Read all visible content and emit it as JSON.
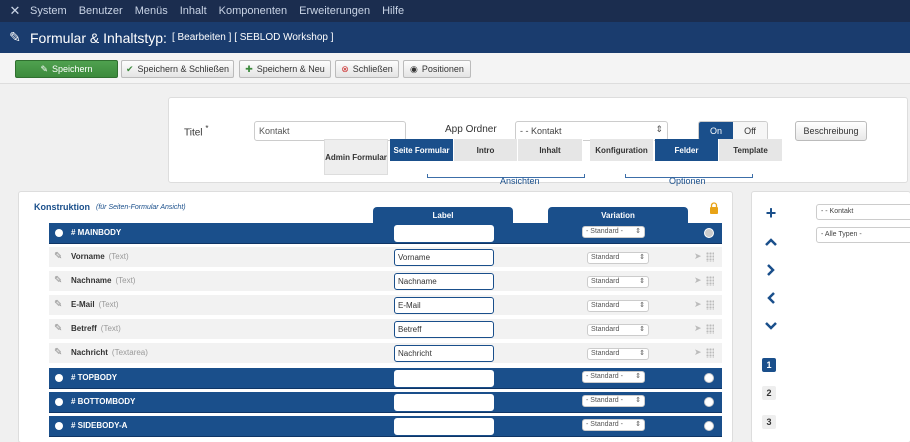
{
  "topnav": {
    "items": [
      "System",
      "Benutzer",
      "Menüs",
      "Inhalt",
      "Komponenten",
      "Erweiterungen",
      "Hilfe"
    ]
  },
  "titlebar": {
    "title": "Formular & Inhaltstyp:",
    "subtitle": "[ Bearbeiten ] [ SEBLOD Workshop ]"
  },
  "toolbar": {
    "save": "Speichern",
    "save_close": "Speichern & Schließen",
    "save_new": "Speichern & Neu",
    "close": "Schließen",
    "positions": "Positionen"
  },
  "form": {
    "title_label": "Titel",
    "title_required": "*",
    "title_value": "Kontakt",
    "app_folder_label": "App Ordner",
    "app_folder_value": "- - Kontakt",
    "toggle_on": "On",
    "toggle_off": "Off",
    "description_button": "Beschreibung"
  },
  "views": {
    "caption": "Ansichten",
    "tabs": [
      {
        "label": "Admin Formular"
      },
      {
        "label": "Seite Formular"
      },
      {
        "label": "Intro"
      },
      {
        "label": "Inhalt"
      }
    ]
  },
  "options": {
    "caption": "Optionen",
    "tabs": [
      {
        "label": "Konfiguration"
      },
      {
        "label": "Felder"
      },
      {
        "label": "Template"
      }
    ]
  },
  "construction": {
    "title": "Konstruktion",
    "subtitle": "(für Seiten-Formular Ansicht)",
    "col_label": "Label",
    "col_variation": "Variation",
    "rows": [
      {
        "kind": "position",
        "name": "# MAINBODY",
        "type": "",
        "label": "",
        "variation": "- Standard -"
      },
      {
        "kind": "field",
        "name": "Vorname",
        "type": "(Text)",
        "label": "Vorname",
        "variation": "Standard"
      },
      {
        "kind": "field",
        "name": "Nachname",
        "type": "(Text)",
        "label": "Nachname",
        "variation": "Standard"
      },
      {
        "kind": "field",
        "name": "E-Mail",
        "type": "(Text)",
        "label": "E-Mail",
        "variation": "Standard"
      },
      {
        "kind": "field",
        "name": "Betreff",
        "type": "(Text)",
        "label": "Betreff",
        "variation": "Standard"
      },
      {
        "kind": "field",
        "name": "Nachricht",
        "type": "(Textarea)",
        "label": "Nachricht",
        "variation": "Standard"
      },
      {
        "kind": "position",
        "name": "# TOPBODY",
        "type": "",
        "label": "",
        "variation": "- Standard -"
      },
      {
        "kind": "position",
        "name": "# BOTTOMBODY",
        "type": "",
        "label": "",
        "variation": "- Standard -"
      },
      {
        "kind": "position",
        "name": "# SIDEBODY-A",
        "type": "",
        "label": "",
        "variation": "- Standard -"
      }
    ]
  },
  "toolbox": {
    "filter_folder": "- - Kontakt",
    "filter_type": "- Alle Typen -",
    "pages": [
      "1",
      "2",
      "3"
    ]
  },
  "colors": {
    "nav_bg": "#1b2d4f",
    "title_bg": "#1a3c6e",
    "accent": "#1a4f8b",
    "save_green": "#3c8a3c"
  }
}
